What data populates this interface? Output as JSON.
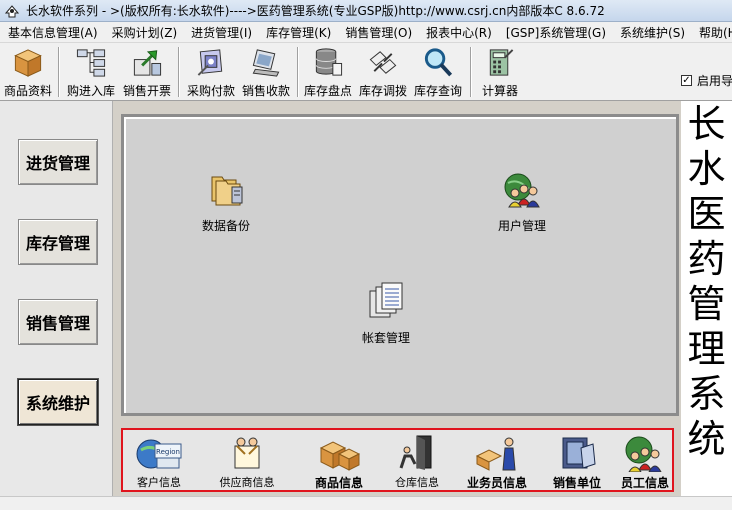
{
  "window": {
    "title": "长水软件系列 - >(版权所有:长水软件)---->医药管理系统(专业GSP版)http://www.csrj.cn内部版本C 8.6.72"
  },
  "menu": [
    {
      "label": "基本信息管理(A)"
    },
    {
      "label": "采购计划(Z)"
    },
    {
      "label": "进货管理(I)"
    },
    {
      "label": "库存管理(K)"
    },
    {
      "label": "销售管理(O)"
    },
    {
      "label": "报表中心(R)"
    },
    {
      "label": "[GSP]系统管理(G)"
    },
    {
      "label": "系统维护(S)"
    },
    {
      "label": "帮助(H)"
    }
  ],
  "toolbar": [
    {
      "label": "商品资料",
      "icon": "box-icon"
    },
    {
      "label": "购进入库",
      "icon": "flowchart-icon"
    },
    {
      "label": "销售开票",
      "icon": "export-icon"
    },
    {
      "label": "采购付款",
      "icon": "payment-icon"
    },
    {
      "label": "销售收款",
      "icon": "computer-icon"
    },
    {
      "label": "库存盘点",
      "icon": "database-icon"
    },
    {
      "label": "库存调拨",
      "icon": "transfer-icon"
    },
    {
      "label": "库存查询",
      "icon": "magnifier-icon"
    },
    {
      "label": "计算器",
      "icon": "calculator-icon"
    }
  ],
  "autostart": {
    "label": "启用导",
    "checked": true
  },
  "sidebar": [
    {
      "label": "进货管理",
      "active": false
    },
    {
      "label": "库存管理",
      "active": false
    },
    {
      "label": "销售管理",
      "active": false
    },
    {
      "label": "系统维护",
      "active": true
    }
  ],
  "workspace": [
    {
      "label": "数据备份",
      "icon": "folders-icon"
    },
    {
      "label": "用户管理",
      "icon": "users-globe-icon"
    },
    {
      "label": "帐套管理",
      "icon": "documents-icon"
    }
  ],
  "bottom": [
    {
      "label": "客户信息",
      "icon": "region-globe-icon",
      "bold": false
    },
    {
      "label": "供应商信息",
      "icon": "supplier-icon",
      "bold": false
    },
    {
      "label": "商品信息",
      "icon": "boxes-icon",
      "bold": true
    },
    {
      "label": "仓库信息",
      "icon": "warehouse-door-icon",
      "bold": false
    },
    {
      "label": "业务员信息",
      "icon": "salesman-icon",
      "bold": true
    },
    {
      "label": "销售单位",
      "icon": "sales-unit-icon",
      "bold": true
    },
    {
      "label": "员工信息",
      "icon": "staff-globe-icon",
      "bold": true
    }
  ],
  "brand": {
    "vertical_title": "长水医药管理系统"
  },
  "colors": {
    "highlight_border": "#e0141d",
    "titlebar": "#c5d6ec"
  }
}
